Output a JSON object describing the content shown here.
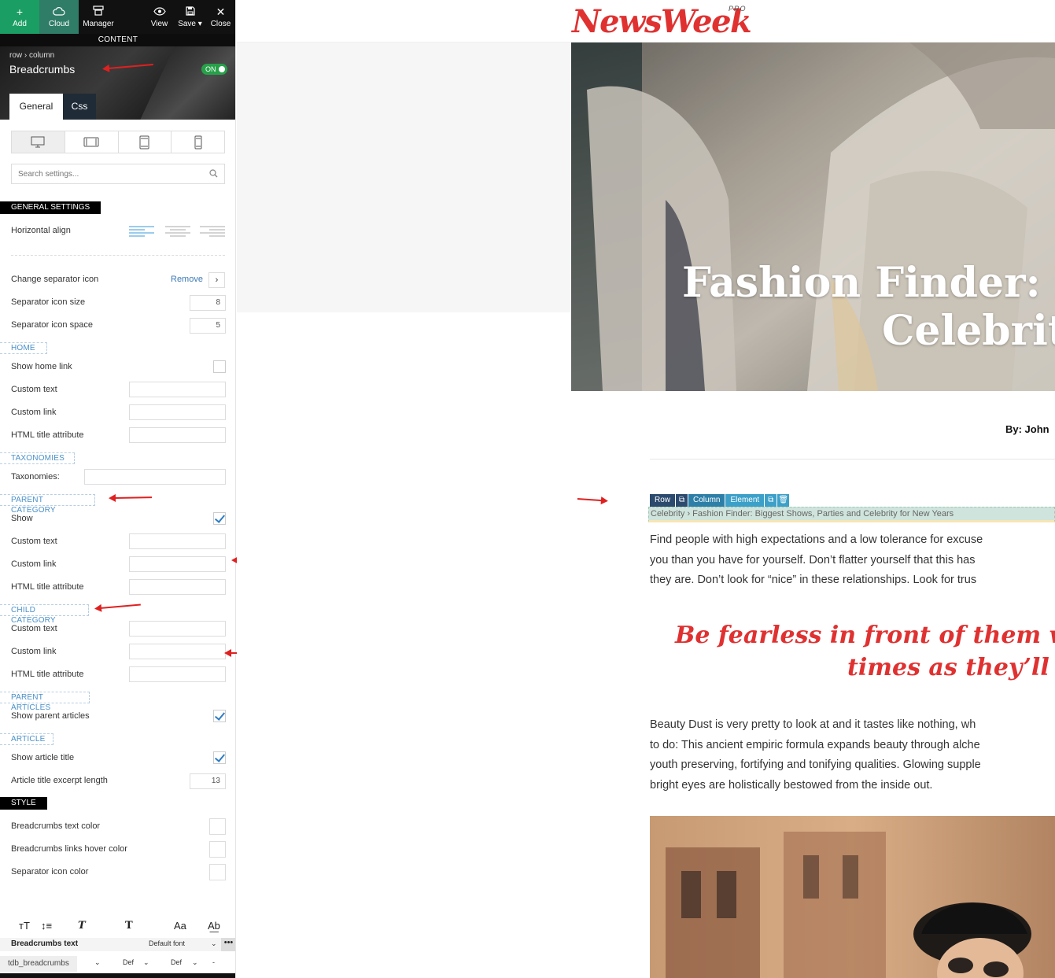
{
  "toolbar": {
    "add": "Add",
    "cloud": "Cloud",
    "manager": "Manager",
    "view": "View",
    "save": "Save",
    "close": "Close",
    "section": "CONTENT"
  },
  "panel": {
    "path": "row  ›  column",
    "title": "Breadcrumbs",
    "toggle": "ON",
    "tabs": {
      "general": "General",
      "css": "Css"
    },
    "search_placeholder": "Search settings..."
  },
  "general": {
    "heading": "GENERAL SETTINGS",
    "horizontal_align": "Horizontal align",
    "change_separator_icon": "Change separator icon",
    "remove": "Remove",
    "separator_icon_size": "Separator icon size",
    "separator_icon_size_value": "8",
    "separator_icon_space": "Separator icon space",
    "separator_icon_space_value": "5"
  },
  "home": {
    "heading": "HOME",
    "show_home_link": "Show home link",
    "custom_text": "Custom text",
    "custom_link": "Custom link",
    "html_title": "HTML title attribute"
  },
  "taxonomies": {
    "heading": "TAXONOMIES",
    "label": "Taxonomies:"
  },
  "parent_category": {
    "heading": "PARENT CATEGORY",
    "show": "Show",
    "custom_text": "Custom text",
    "custom_link": "Custom link",
    "html_title": "HTML title attribute"
  },
  "child_category": {
    "heading": "CHILD CATEGORY",
    "custom_text": "Custom text",
    "custom_link": "Custom link",
    "html_title": "HTML title attribute"
  },
  "parent_articles": {
    "heading": "PARENT ARTICLES",
    "show": "Show parent articles"
  },
  "article": {
    "heading": "ARTICLE",
    "show_title": "Show article title",
    "excerpt_length": "Article title excerpt length",
    "excerpt_length_value": "13"
  },
  "style": {
    "heading": "STYLE",
    "text_color": "Breadcrumbs text color",
    "hover_color": "Breadcrumbs links hover color",
    "separator_color": "Separator icon color"
  },
  "typography": {
    "label": "Breadcrumbs text",
    "font": "Default font",
    "dots": "•••",
    "shortcode": "tdb_breadcrumbs",
    "def1": "Def",
    "def2": "Def",
    "dash": "-"
  },
  "preview": {
    "logo": "NewsWeek",
    "logo_pro": "PRO",
    "hero_title_line1": "Fashion Finder: Bi",
    "hero_title_line2": "Celebrity",
    "byline": "By:   John",
    "tags": {
      "row": "Row",
      "column": "Column",
      "element": "Element"
    },
    "breadcrumb": "Celebrity  ›  Fashion Finder: Biggest Shows, Parties and Celebrity for New Years",
    "para1": [
      "Find people with high expectations and a low tolerance for excuse",
      "you than you have for yourself. Don’t flatter yourself that this has",
      "they are. Don’t look for “nice” in these relationships. Look for trus"
    ],
    "quote_line1": "Be fearless in front of them with",
    "quote_line2": "times as they’ll let",
    "para2": [
      "Beauty Dust is very pretty to look at and it tastes like nothing, wh",
      "to do: This ancient empiric formula expands beauty through alche",
      "youth preserving, fortifying and tonifying qualities. Glowing supple",
      "bright eyes are holistically bestowed from the inside out."
    ]
  },
  "colors": {
    "accent_red": "#e03131",
    "toggle_green": "#27a149",
    "link_blue": "#3b7ab6",
    "add_green": "#1b9e63"
  }
}
